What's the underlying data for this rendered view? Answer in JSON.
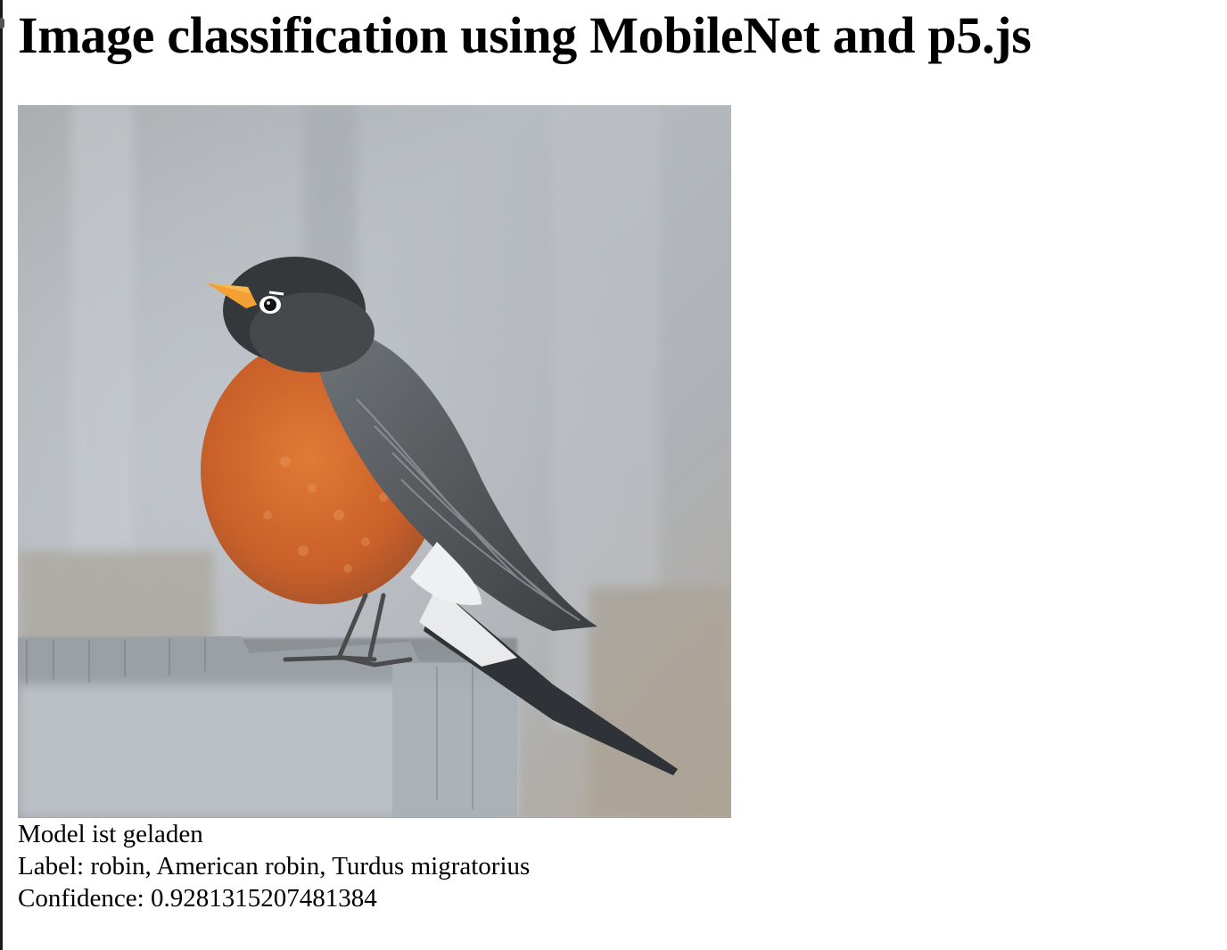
{
  "page": {
    "title": "Image classification using MobileNet and p5.js"
  },
  "image": {
    "subject": "american-robin-photo"
  },
  "result": {
    "status": "Model ist geladen",
    "label_text": "Label: robin, American robin, Turdus migratorius",
    "confidence_text": "Confidence: 0.9281315207481384"
  }
}
